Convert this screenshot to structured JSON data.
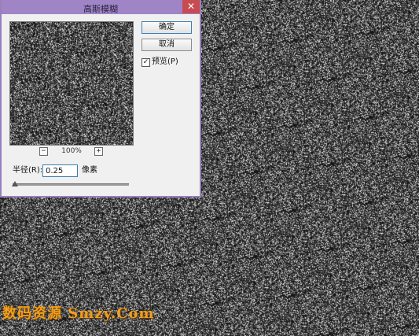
{
  "dialog": {
    "title": "高斯模糊",
    "close_symbol": "✕",
    "ok_label": "确定",
    "cancel_label": "取消",
    "preview_label": "预览(P)",
    "preview_checked": true,
    "check_mark": "✓",
    "zoom_minus": "−",
    "zoom_plus": "+",
    "zoom_level": "100%",
    "radius_label": "半径(R):",
    "radius_value": "0.25",
    "radius_unit": "像素",
    "slider_position_fraction": 0.02
  },
  "watermark": {
    "text": "数码资源 Smzy.Com"
  },
  "colors": {
    "titlebar": "#9f84c6",
    "close_button": "#c74b50",
    "dialog_bg": "#f0f0f0",
    "watermark": "#f0a020"
  },
  "icons": {
    "close": "close-icon",
    "zoom_out": "minus-icon",
    "zoom_in": "plus-icon",
    "checkbox": "check-icon"
  }
}
